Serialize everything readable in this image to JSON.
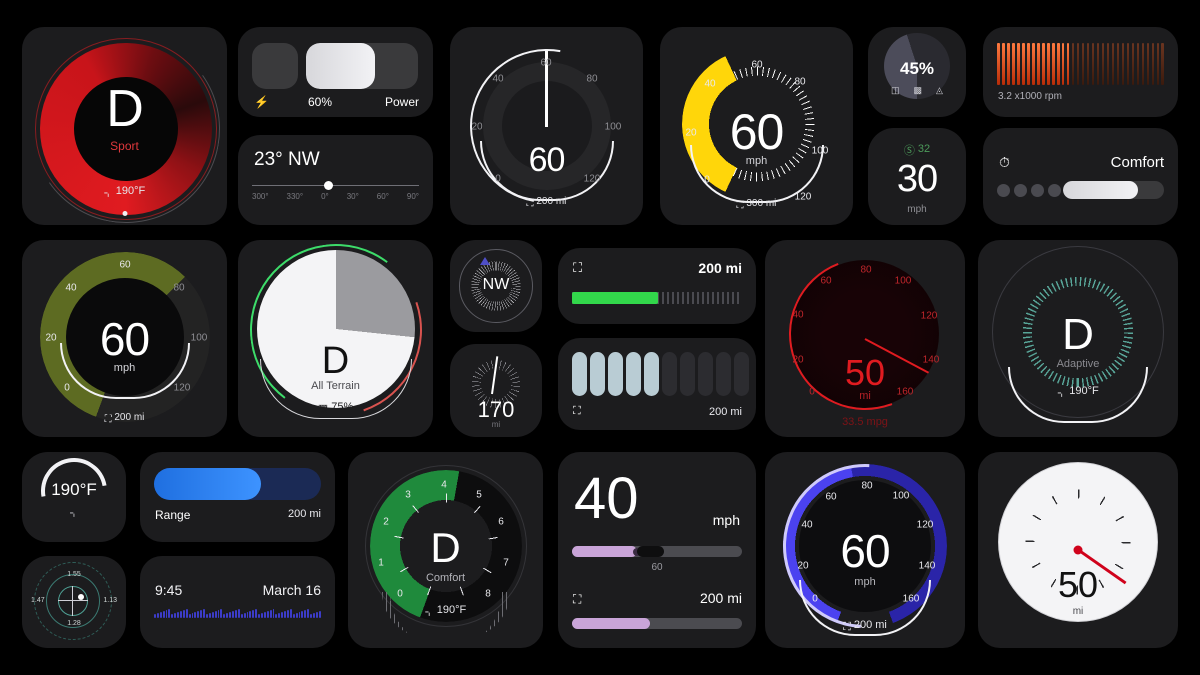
{
  "gallery": {
    "title": "Automotive dashboard widget gallery",
    "background": "#000000"
  },
  "widgets": [
    {
      "id": "drive-mode-sport",
      "name": "drive-mode-sport-dial",
      "gear": "D",
      "mode": "Sport",
      "temp": "190°F",
      "temp_icon": "coolant-temp-icon",
      "accent": "#e01b20"
    },
    {
      "id": "power-meter",
      "name": "power-meter-bar",
      "percent_label": "60%",
      "right_label": "Power",
      "bolt_icon": "bolt-icon",
      "fill_percent": 60,
      "accent": "#e9e9ee"
    },
    {
      "id": "heading-slider",
      "name": "heading-slider",
      "heading": "23° NW",
      "ticks": [
        "300°",
        "330°",
        "0°",
        "30°",
        "60°",
        "90°"
      ],
      "knob_percent": 46
    },
    {
      "id": "speedo-dark",
      "name": "speedometer-dark",
      "value": "60",
      "ticks": [
        "0",
        "20",
        "40",
        "60",
        "80",
        "100",
        "120"
      ],
      "range_icon": "fuel-icon",
      "range": "200 mi",
      "accent": "#ffffff"
    },
    {
      "id": "speedo-yellow",
      "name": "speedometer-yellow",
      "value": "60",
      "unit": "mph",
      "ticks": [
        "0",
        "20",
        "40",
        "60",
        "80",
        "100",
        "120"
      ],
      "range_icon": "fuel-icon",
      "range": "300 mi",
      "accent": "#ffd60a"
    },
    {
      "id": "battery-pie",
      "name": "battery-charge-pie",
      "percent": "45%",
      "icons": [
        "battery-empty-icon",
        "battery-charging-icon",
        "battery-full-icon"
      ],
      "accent": "#5a5a68"
    },
    {
      "id": "speed-limit",
      "name": "speed-limit-readout",
      "limit_badge": "32",
      "badge_icon": "speed-limit-sign-icon",
      "value": "30",
      "unit": "mph",
      "accent": "#30d158"
    },
    {
      "id": "tachometer-bars",
      "name": "tachometer-bar-strip",
      "label": "3.2 x1000 rpm",
      "value": 3.2,
      "max": 8,
      "bars_total": 34,
      "bars_active": 15,
      "accent": "#ff5a1f"
    },
    {
      "id": "drive-mode-comfort",
      "name": "drive-mode-selector-comfort",
      "mode": "Comfort",
      "mode_icon": "drive-mode-icon",
      "dots": 4,
      "active_dot": 4,
      "fill_percent": 62,
      "accent": "#e9e9ee"
    },
    {
      "id": "speedo-olive",
      "name": "speedometer-olive",
      "value": "60",
      "unit": "mph",
      "ticks": [
        "0",
        "20",
        "40",
        "60",
        "80",
        "100",
        "120"
      ],
      "range_icon": "fuel-icon",
      "range": "200 mi",
      "accent": "#5d6b22"
    },
    {
      "id": "all-terrain",
      "name": "all-terrain-dial",
      "gear": "D",
      "mode": "All Terrain",
      "battery_icon": "battery-icon",
      "battery": "75%",
      "accent": "#f2f2f5",
      "arc_left": "#3ddc6a",
      "arc_right": "#d9534f"
    },
    {
      "id": "compass-nw",
      "name": "compass-nw",
      "heading": "NW",
      "accent": "#ffffff"
    },
    {
      "id": "odometer-170",
      "name": "odometer-gauge-170",
      "value": "170",
      "unit": "mi",
      "accent": "#ffffff"
    },
    {
      "id": "fuel-bar-green",
      "name": "fuel-range-bar-green",
      "icon": "fuel-pump-icon",
      "range": "200 mi",
      "fill_percent": 55,
      "accent": "#32d74b"
    },
    {
      "id": "fuel-segments",
      "name": "fuel-segment-bar",
      "icon": "fuel-pump-icon",
      "range": "200 mi",
      "segments_total": 10,
      "segments_active": 5,
      "accent": "#b9ccd4"
    },
    {
      "id": "gauge-red",
      "name": "range-gauge-red",
      "value": "50",
      "unit": "mi",
      "ticks": [
        "0",
        "20",
        "40",
        "60",
        "80",
        "100",
        "120",
        "140",
        "160"
      ],
      "footer": "33.5 mpg",
      "accent": "#e01b20"
    },
    {
      "id": "drive-mode-adaptive",
      "name": "drive-mode-adaptive-dial",
      "gear": "D",
      "mode": "Adaptive",
      "temp_icon": "coolant-temp-icon",
      "temp": "190°F",
      "accent": "#58a598"
    },
    {
      "id": "coolant-temp",
      "name": "coolant-temp-dial",
      "value": "190°F",
      "icon": "coolant-temp-icon",
      "accent": "#ffffff"
    },
    {
      "id": "range-bar-blue",
      "name": "range-bar-blue",
      "label": "Range",
      "range": "200 mi",
      "fill_percent": 64,
      "accent": "#0a84ff"
    },
    {
      "id": "g-force",
      "name": "g-force-meter",
      "top": "1.55",
      "left": "1.47",
      "right": "1.13",
      "bottom": "1.28",
      "accent": "#4e9f93"
    },
    {
      "id": "trip-timeline",
      "name": "trip-timeline",
      "time": "9:45",
      "date": "March 16",
      "bars_total": 58,
      "accent": "#3c3cc8"
    },
    {
      "id": "tacho-comfort",
      "name": "tachometer-comfort-dial",
      "gear": "D",
      "mode": "Comfort",
      "temp_icon": "coolant-temp-icon",
      "temp": "190°F",
      "ticks": [
        "0",
        "1",
        "2",
        "3",
        "4",
        "5",
        "6",
        "7",
        "8"
      ],
      "accent": "#1f8a3c"
    },
    {
      "id": "speed-sliders",
      "name": "speed-and-fuel-sliders",
      "value": "40",
      "unit": "mph",
      "speed_marker": "60",
      "speed_fill_percent": 38,
      "fuel_icon": "fuel-pump-icon",
      "range": "200 mi",
      "fuel_fill_percent": 46,
      "accent": "#c9a4d8"
    },
    {
      "id": "speedo-blue",
      "name": "speedometer-blue",
      "value": "60",
      "unit": "mph",
      "ticks": [
        "0",
        "20",
        "40",
        "60",
        "80",
        "100",
        "120",
        "140",
        "160"
      ],
      "range_icon": "fuel-icon",
      "range": "200 mi",
      "accent": "#3b34d6"
    },
    {
      "id": "analog-white",
      "name": "analog-gauge-white",
      "value": "50",
      "unit": "mi",
      "needle_color": "#d0021b",
      "accent": "#f5f5f7"
    }
  ]
}
